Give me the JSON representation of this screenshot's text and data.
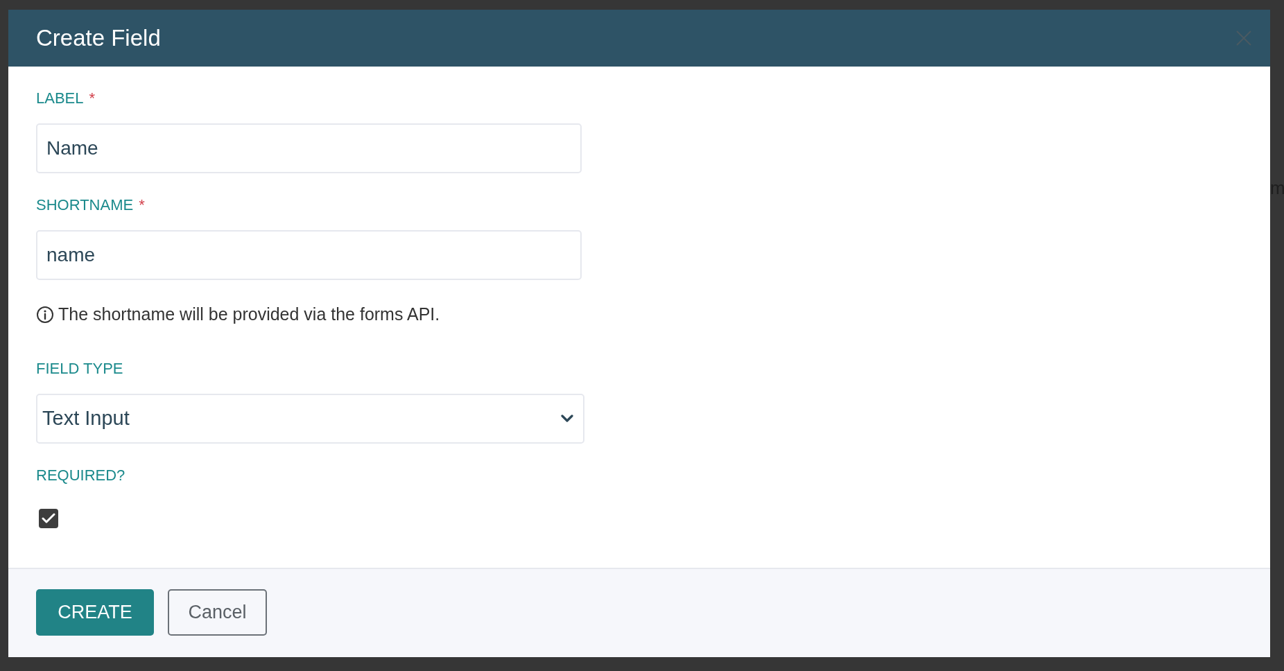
{
  "dialog": {
    "title": "Create Field",
    "fields": [
      {
        "kind": "text",
        "label": "LABEL",
        "required_mark": "*",
        "value": "Name"
      },
      {
        "kind": "text",
        "label": "SHORTNAME",
        "required_mark": "*",
        "value": "name",
        "hint": "The shortname will be provided via the forms API."
      },
      {
        "kind": "select",
        "label": "FIELD TYPE",
        "value": "Text Input"
      },
      {
        "kind": "checkbox",
        "label": "REQUIRED?",
        "checked": true
      }
    ],
    "buttons": [
      {
        "kind": "primary",
        "label": "CREATE"
      },
      {
        "kind": "secondary",
        "label": "Cancel"
      }
    ]
  },
  "background_text": "m"
}
